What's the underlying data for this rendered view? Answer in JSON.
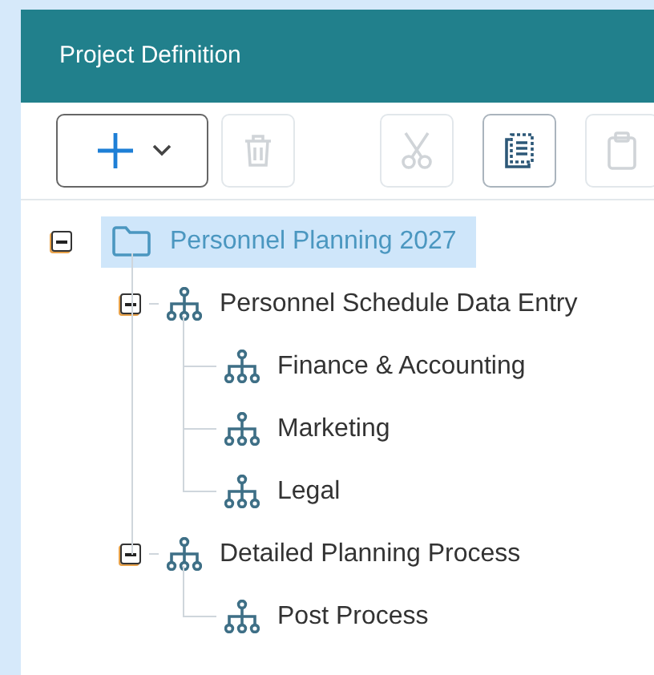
{
  "panel": {
    "title": "Project Definition"
  },
  "toolbar": [
    {
      "kind": "add",
      "disabled": false
    },
    {
      "kind": "delete",
      "disabled": true
    },
    {
      "kind": "cut",
      "disabled": true
    },
    {
      "kind": "copy",
      "disabled": false
    },
    {
      "kind": "paste",
      "disabled": true
    }
  ],
  "tree": [
    {
      "label": "Personnel Planning 2027",
      "kind": "folder",
      "selected": true,
      "expanded": true,
      "children": [
        {
          "label": "Personnel Schedule Data Entry",
          "kind": "process",
          "selected": false,
          "expanded": true,
          "children": [
            {
              "label": "Finance & Accounting",
              "kind": "process",
              "selected": false
            },
            {
              "label": "Marketing",
              "kind": "process",
              "selected": false
            },
            {
              "label": "Legal",
              "kind": "process",
              "selected": false
            }
          ]
        },
        {
          "label": "Detailed Planning Process",
          "kind": "process",
          "selected": false,
          "expanded": true,
          "children": [
            {
              "label": "Post Process",
              "kind": "process",
              "selected": false
            }
          ]
        }
      ]
    }
  ]
}
